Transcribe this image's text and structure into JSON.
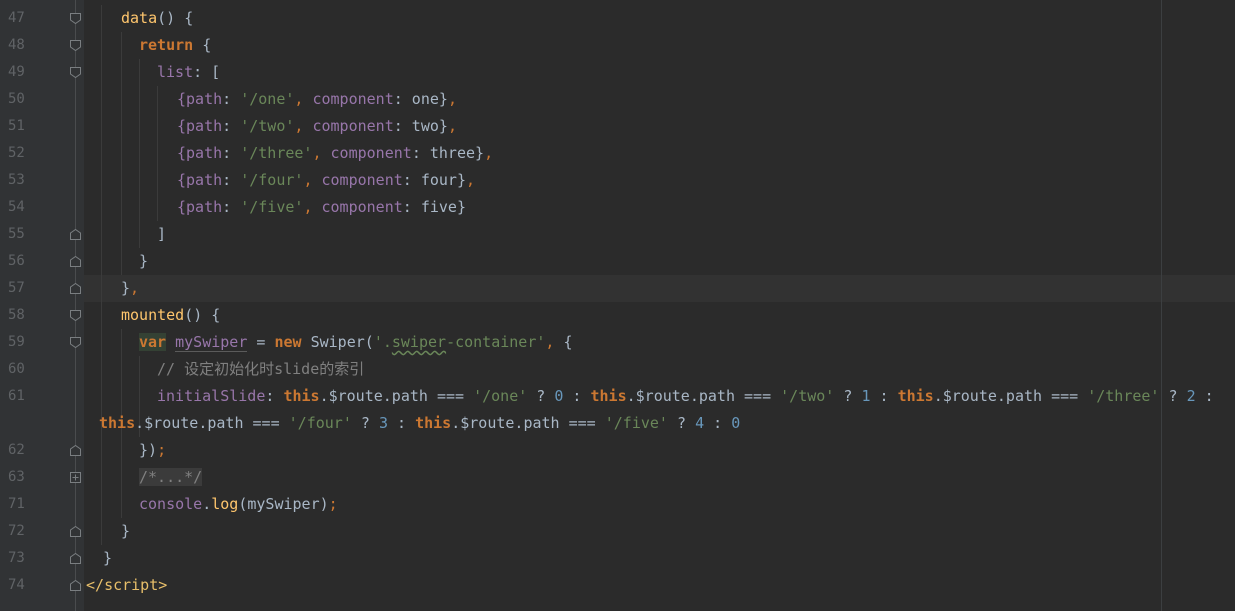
{
  "editor": {
    "lines": [
      {
        "num": "47",
        "code": [
          "data",
          "()",
          " {"
        ]
      },
      {
        "num": "48",
        "code": [
          "return",
          " {"
        ]
      },
      {
        "num": "49",
        "code": [
          "list",
          ": ["
        ]
      },
      {
        "num": "50",
        "code": [
          "{",
          "path",
          ": ",
          "'/one'",
          ", ",
          "component",
          ": one}",
          ","
        ]
      },
      {
        "num": "51",
        "code": [
          "{",
          "path",
          ": ",
          "'/two'",
          ", ",
          "component",
          ": two}",
          ","
        ]
      },
      {
        "num": "52",
        "code": [
          "{",
          "path",
          ": ",
          "'/three'",
          ", ",
          "component",
          ": three}",
          ","
        ]
      },
      {
        "num": "53",
        "code": [
          "{",
          "path",
          ": ",
          "'/four'",
          ", ",
          "component",
          ": four}",
          ","
        ]
      },
      {
        "num": "54",
        "code": [
          "{",
          "path",
          ": ",
          "'/five'",
          ", ",
          "component",
          ": five}"
        ]
      },
      {
        "num": "55",
        "code": [
          "]"
        ]
      },
      {
        "num": "56",
        "code": [
          "}"
        ]
      },
      {
        "num": "57",
        "code": [
          "}",
          ","
        ]
      },
      {
        "num": "58",
        "code": [
          "mounted",
          "()",
          " {"
        ]
      },
      {
        "num": "59",
        "code": [
          "var",
          " ",
          "mySwiper",
          " = ",
          "new",
          " Swiper(",
          "'.",
          "swiper",
          "-container'",
          ", ",
          "{"
        ]
      },
      {
        "num": "60",
        "code": [
          "// 设定初始化时slide的索引"
        ]
      },
      {
        "num": "61",
        "code": [
          "initialSlide",
          ": ",
          "this",
          ".$route.path === ",
          "'/one'",
          " ? ",
          "0",
          " : ",
          "this",
          ".$route.path === ",
          "'/two'",
          " ? ",
          "1",
          " : ",
          "this",
          ".$route.path === ",
          "'/three'",
          " ? ",
          "2",
          " :"
        ]
      },
      {
        "num": "",
        "code": [
          "this",
          ".$route.path === ",
          "'/four'",
          " ? ",
          "3",
          " : ",
          "this",
          ".$route.path === ",
          "'/five'",
          " ? ",
          "4",
          " : ",
          "0"
        ]
      },
      {
        "num": "62",
        "code": [
          "})",
          ";"
        ]
      },
      {
        "num": "63",
        "code": [
          "/*...*/"
        ]
      },
      {
        "num": "71",
        "code": [
          "console",
          ".",
          "log",
          "(mySwiper)",
          ";"
        ]
      },
      {
        "num": "72",
        "code": [
          "}"
        ]
      },
      {
        "num": "73",
        "code": [
          "}"
        ]
      },
      {
        "num": "74",
        "code": [
          "</",
          "script",
          ">"
        ]
      }
    ]
  },
  "colors": {
    "background": "#2B2B2B",
    "gutter": "#313335",
    "keyword": "#CC7832",
    "function": "#FFC66D",
    "property": "#9876AA",
    "string": "#6A8759",
    "number": "#6897BB",
    "comment": "#808080",
    "text": "#A9B7C6"
  },
  "icons": [
    "fold-start-icon",
    "fold-end-icon",
    "fold-collapsed-icon"
  ]
}
